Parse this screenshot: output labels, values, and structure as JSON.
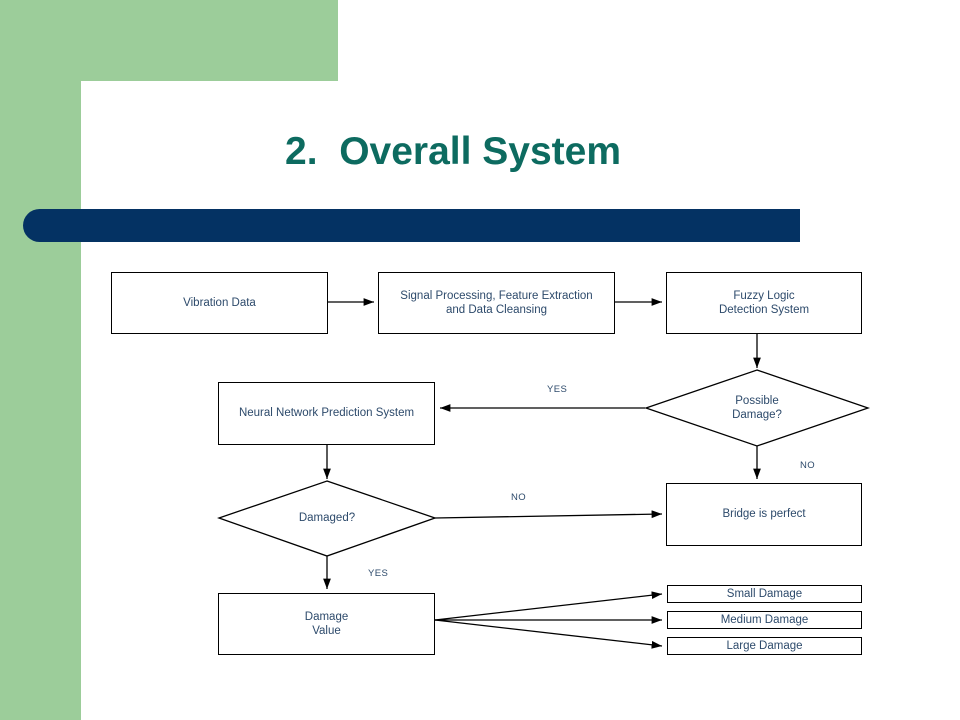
{
  "slide": {
    "title": "2.  Overall System",
    "background_color": "#ffffff",
    "accent_green": "#9ccd9a",
    "accent_blue": "#043263",
    "title_color": "#0d6b60",
    "node_text_color": "#2d4a6b"
  },
  "flowchart": {
    "nodes": {
      "vibration_data": "Vibration Data",
      "signal_processing": "Signal Processing, Feature Extraction\nand Data Cleansing",
      "fuzzy_logic": "Fuzzy Logic\nDetection System",
      "possible_damage": "Possible\nDamage?",
      "neural_network": "Neural Network Prediction System",
      "damaged": "Damaged?",
      "bridge_perfect": "Bridge is perfect",
      "damage_value": "Damage\nValue",
      "small_damage": "Small Damage",
      "medium_damage": "Medium Damage",
      "large_damage": "Large Damage"
    },
    "edge_labels": {
      "possible_damage_yes": "YES",
      "possible_damage_no": "NO",
      "damaged_no": "NO",
      "damaged_yes": "YES"
    }
  }
}
